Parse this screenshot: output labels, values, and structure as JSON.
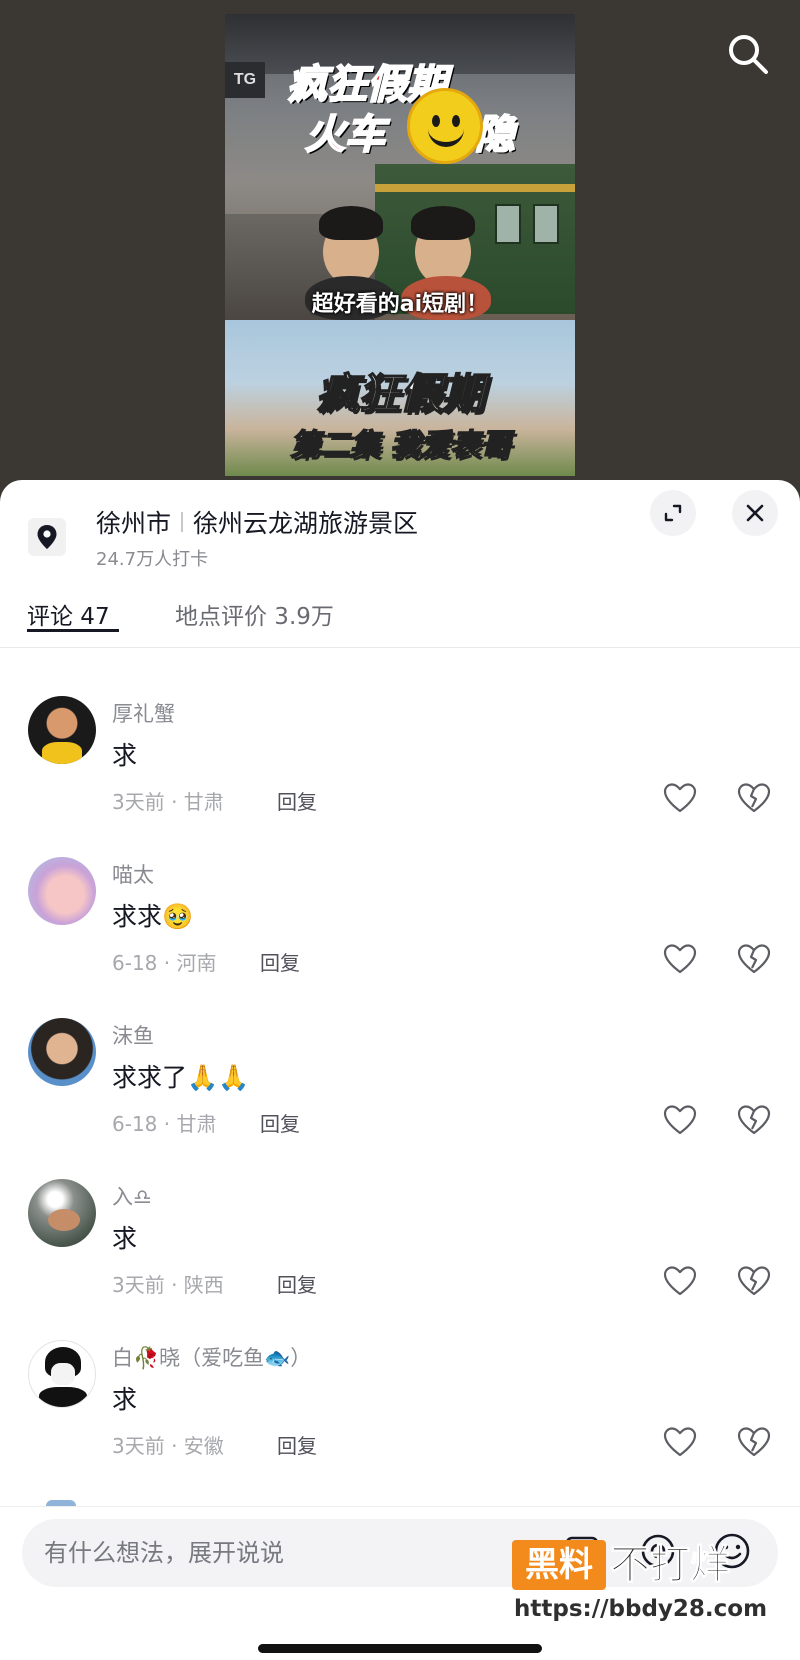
{
  "video": {
    "sign_text": "TG",
    "title_line1": "疯狂假期",
    "title_line2": "火车",
    "title_line2_tail": "隐",
    "subtitle": "超好看的ai短剧！",
    "bottom_title": "疯狂假期",
    "bottom_episode": "第二集  我爱表哥"
  },
  "location": {
    "city": "徐州市",
    "place": "徐州云龙湖旅游景区",
    "checkins": "24.7万人打卡"
  },
  "tabs": [
    {
      "label": "评论 47"
    },
    {
      "label": "地点评价 3.9万"
    }
  ],
  "comments": [
    {
      "name": "厚礼蟹",
      "text": "求",
      "meta": "3天前 · 甘肃",
      "reply": "回复"
    },
    {
      "name": "喵太",
      "text": "求求🥹",
      "meta": "6-18 · 河南",
      "reply": "回复"
    },
    {
      "name": "沫鱼",
      "text": "求求了🙏🙏",
      "meta": "6-18 · 甘肃",
      "reply": "回复"
    },
    {
      "name": "入♎",
      "text": "求",
      "meta": "3天前 · 陕西",
      "reply": "回复"
    },
    {
      "name": "白🥀晓（爱吃鱼🐟）",
      "text": "求",
      "meta": "3天前 · 安徽",
      "reply": "回复"
    }
  ],
  "input": {
    "placeholder": "有什么想法，展开说说"
  },
  "watermark": {
    "box": "黑料",
    "side": "不打烊",
    "url": "https://bbdy28.com"
  },
  "colors": {
    "sheet_bg": "#ffffff",
    "text_primary": "#161823",
    "text_secondary": "#8a8b91",
    "watermark_orange": "#f28a1c"
  },
  "icons": [
    "search-icon",
    "location-pin-icon",
    "expand-icon",
    "close-icon",
    "heart-icon",
    "broken-heart-icon",
    "image-icon",
    "at-icon",
    "emoji-icon"
  ]
}
